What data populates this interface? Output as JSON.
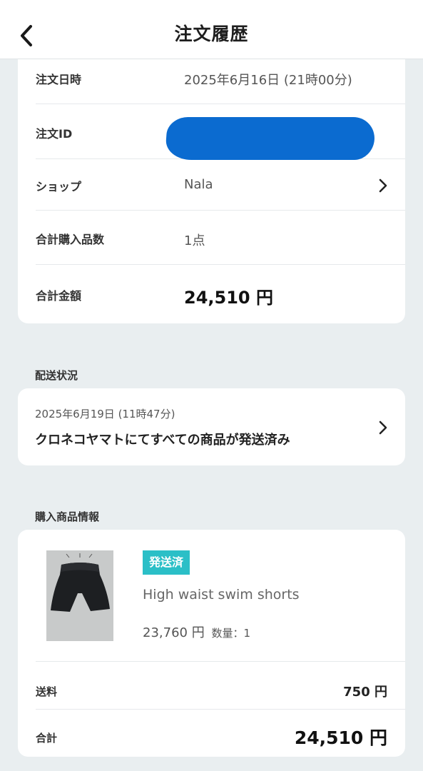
{
  "header": {
    "title": "注文履歴"
  },
  "summary": {
    "order_date_label": "注文日時",
    "order_date_value": "2025年6月16日 (21時00分)",
    "order_id_label": "注文ID",
    "shop_label": "ショップ",
    "shop_value": "Nala",
    "item_count_label": "合計購入品数",
    "item_count_value": "1点",
    "total_label": "合計金額",
    "total_value": "24,510 円"
  },
  "delivery": {
    "heading": "配送状況",
    "date": "2025年6月19日 (11時47分)",
    "status": "クロネコヤマトにてすべての商品が発送済み"
  },
  "product_info": {
    "heading": "購入商品情報",
    "badge": "発送済",
    "name": "High waist swim shorts",
    "price": "23,760 円",
    "quantity": "数量：1",
    "shipping_label": "送料",
    "shipping_value": "750 円",
    "total_label": "合計",
    "total_value": "24,510 円"
  },
  "colors": {
    "accent_badge": "#2bbfc7",
    "redaction": "#0b6bd0",
    "background": "#e9eef0"
  }
}
